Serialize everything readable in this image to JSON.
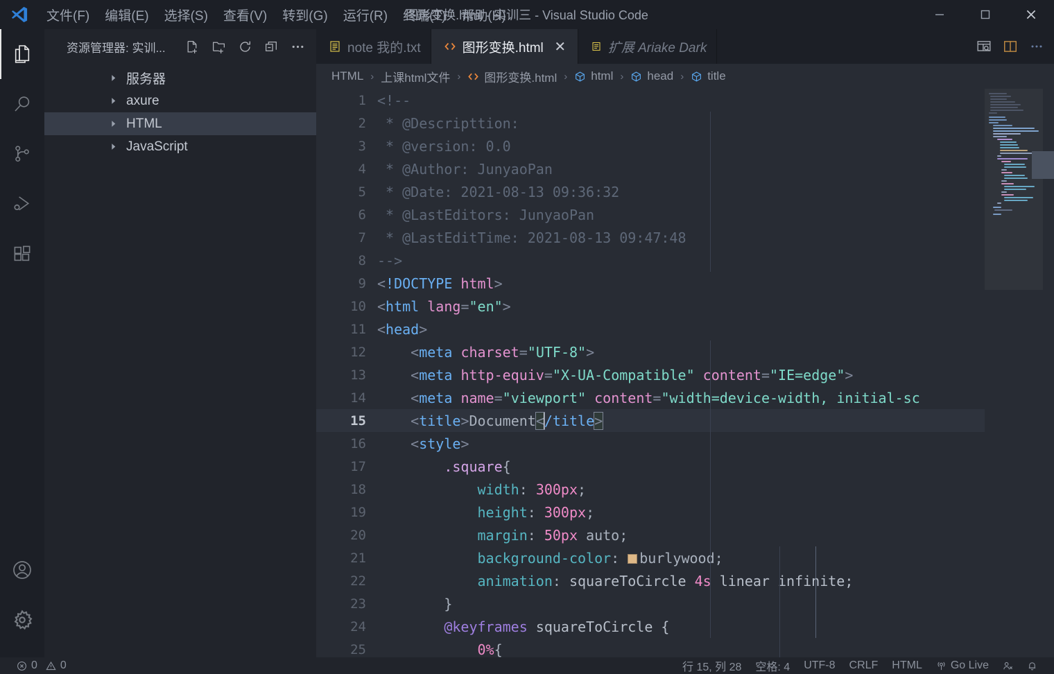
{
  "window": {
    "title": "图形变换.html - 实训三 - Visual Studio Code",
    "minimize_label": "最小化",
    "maximize_label": "最大化",
    "close_label": "关闭"
  },
  "menubar": {
    "items": [
      {
        "label": "文件(F)",
        "name": "menu-file"
      },
      {
        "label": "编辑(E)",
        "name": "menu-edit"
      },
      {
        "label": "选择(S)",
        "name": "menu-selection"
      },
      {
        "label": "查看(V)",
        "name": "menu-view"
      },
      {
        "label": "转到(G)",
        "name": "menu-go"
      },
      {
        "label": "运行(R)",
        "name": "menu-run"
      },
      {
        "label": "终端(T)",
        "name": "menu-terminal"
      },
      {
        "label": "帮助(H)",
        "name": "menu-help"
      }
    ]
  },
  "activitybar": {
    "items": [
      {
        "icon": "files-explorer-icon",
        "active": true
      },
      {
        "icon": "search-icon",
        "active": false
      },
      {
        "icon": "source-control-icon",
        "active": false
      },
      {
        "icon": "run-and-debug-icon",
        "active": false
      },
      {
        "icon": "extensions-icon",
        "active": false
      }
    ],
    "bottom_items": [
      {
        "icon": "account-icon"
      },
      {
        "icon": "gear-icon"
      }
    ]
  },
  "sidebar": {
    "title": "资源管理器: 实训...",
    "actions": [
      {
        "icon": "new-file-icon",
        "label": "新建文件"
      },
      {
        "icon": "new-folder-icon",
        "label": "新建文件夹"
      },
      {
        "icon": "refresh-icon",
        "label": "刷新资源管理器"
      },
      {
        "icon": "collapse-all-icon",
        "label": "全部折叠"
      },
      {
        "icon": "more-actions-icon",
        "label": "视图和更多操作..."
      }
    ],
    "tree": [
      {
        "label": "服务器",
        "selected": false,
        "expanded": false
      },
      {
        "label": "axure",
        "selected": false,
        "expanded": false
      },
      {
        "label": "HTML",
        "selected": true,
        "expanded": false
      },
      {
        "label": "JavaScript",
        "selected": false,
        "expanded": false
      }
    ]
  },
  "tabs": [
    {
      "label": "note 我的.txt",
      "icon": "text-file-icon",
      "active": false,
      "preview": false,
      "closable": false
    },
    {
      "label": "图形变换.html",
      "icon": "html-file-icon",
      "active": true,
      "preview": false,
      "closable": true
    },
    {
      "label": "扩展 Ariake Dark",
      "icon": "extensions-list-icon",
      "active": false,
      "preview": true,
      "closable": false
    }
  ],
  "tab_actions": [
    {
      "icon": "open-preview-icon",
      "label": "打开预览"
    },
    {
      "icon": "split-editor-icon",
      "label": "拆分编辑器"
    },
    {
      "icon": "more-actions-icon",
      "label": "更多操作..."
    }
  ],
  "breadcrumb": {
    "items": [
      {
        "label": "HTML",
        "icon": "none"
      },
      {
        "label": "上课html文件",
        "icon": "none"
      },
      {
        "label": "图形变换.html",
        "icon": "html-file-icon"
      },
      {
        "label": "html",
        "icon": "symbol-field-icon"
      },
      {
        "label": "head",
        "icon": "symbol-field-icon"
      },
      {
        "label": "title",
        "icon": "symbol-field-icon"
      }
    ],
    "separator": "›"
  },
  "editor": {
    "current_line": 15,
    "first_line": 1,
    "lines": [
      {
        "n": 1,
        "text": "<!--"
      },
      {
        "n": 2,
        "text": " * @Descripttion:"
      },
      {
        "n": 3,
        "text": " * @version: 0.0"
      },
      {
        "n": 4,
        "text": " * @Author: JunyaoPan"
      },
      {
        "n": 5,
        "text": " * @Date: 2021-08-13 09:36:32"
      },
      {
        "n": 6,
        "text": " * @LastEditors: JunyaoPan"
      },
      {
        "n": 7,
        "text": " * @LastEditTime: 2021-08-13 09:47:48"
      },
      {
        "n": 8,
        "text": "-->"
      },
      {
        "n": 9,
        "text": "<!DOCTYPE html>"
      },
      {
        "n": 10,
        "text": "<html lang=\"en\">"
      },
      {
        "n": 11,
        "text": "<head>"
      },
      {
        "n": 12,
        "text": "    <meta charset=\"UTF-8\">"
      },
      {
        "n": 13,
        "text": "    <meta http-equiv=\"X-UA-Compatible\" content=\"IE=edge\">"
      },
      {
        "n": 14,
        "text": "    <meta name=\"viewport\" content=\"width=device-width, initial-sc"
      },
      {
        "n": 15,
        "text": "    <title>Document</title>"
      },
      {
        "n": 16,
        "text": "    <style>"
      },
      {
        "n": 17,
        "text": "        .square{"
      },
      {
        "n": 18,
        "text": "            width: 300px;"
      },
      {
        "n": 19,
        "text": "            height: 300px;"
      },
      {
        "n": 20,
        "text": "            margin: 50px auto;"
      },
      {
        "n": 21,
        "text": "            background-color: burlywood;"
      },
      {
        "n": 22,
        "text": "            animation: squareToCircle 4s linear infinite;"
      },
      {
        "n": 23,
        "text": "        }"
      },
      {
        "n": 24,
        "text": "        @keyframes squareToCircle {"
      },
      {
        "n": 25,
        "text": "            0%{"
      }
    ],
    "color_swatch": "#deb887"
  },
  "statusbar": {
    "errors": "0",
    "warnings": "0",
    "cursor_position": "行 15, 列 28",
    "indentation": "空格: 4",
    "encoding": "UTF-8",
    "eol": "CRLF",
    "language": "HTML",
    "go_live": "Go Live",
    "remote_icon": "remote-window-icon",
    "bell_icon": "notifications-bell-icon"
  },
  "colors": {
    "titlebar_bg": "#1c1f26",
    "sidebar_bg": "#21242b",
    "editor_bg": "#282c34",
    "selected_row": "#373d49",
    "accent_orange": "#e8863c",
    "accent_blue": "#5c9ae0",
    "text_muted": "#8b919c"
  }
}
